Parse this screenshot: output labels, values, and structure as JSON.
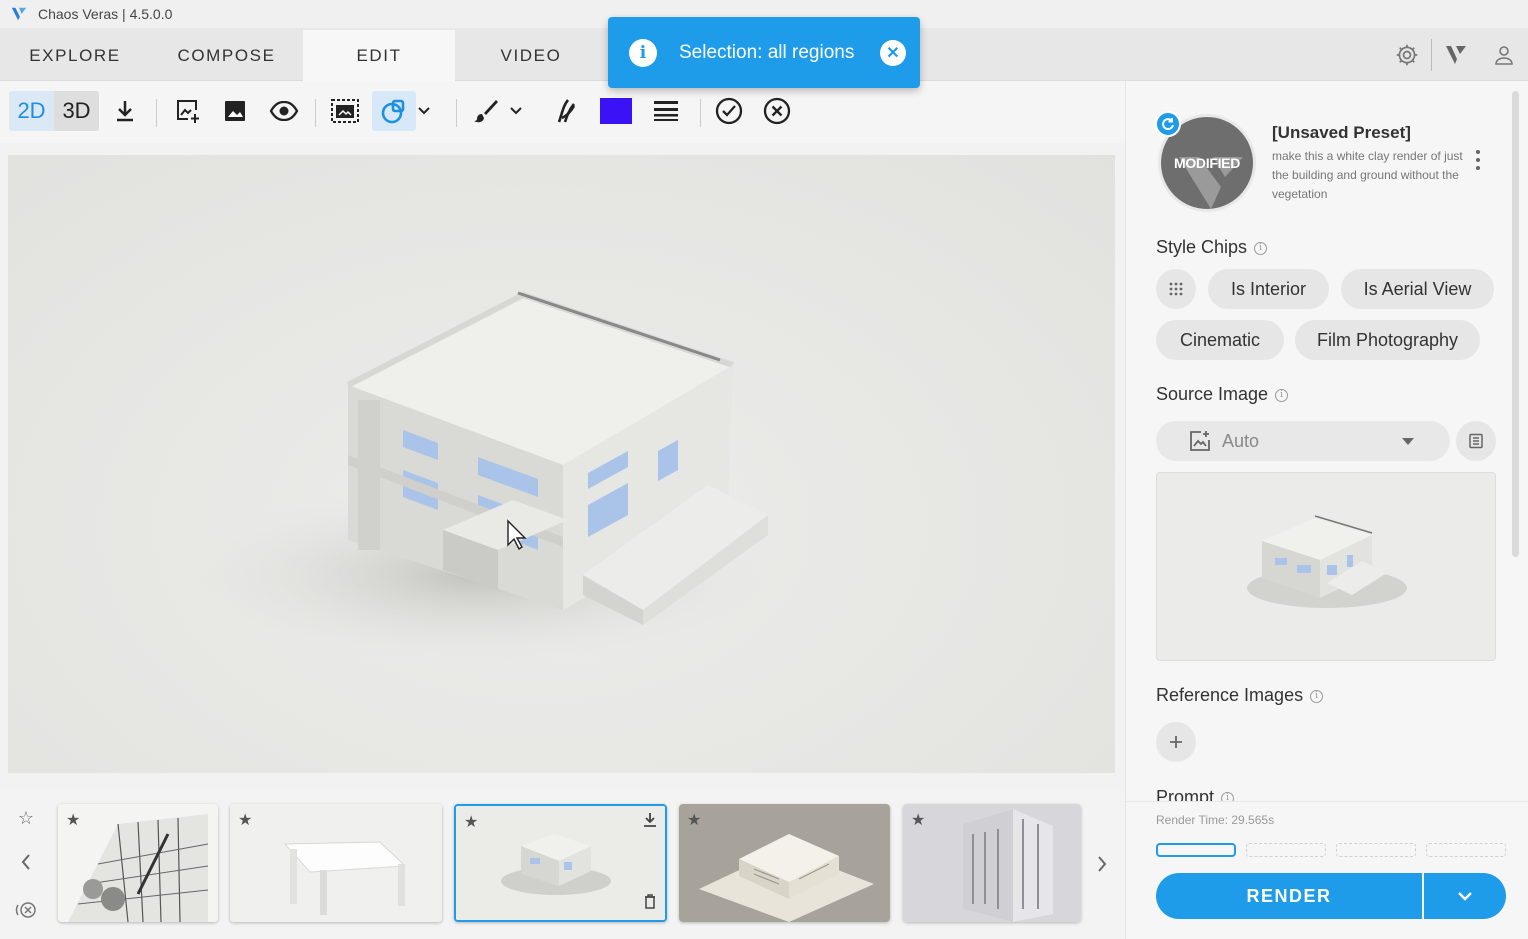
{
  "app": {
    "title": "Chaos Veras | 4.5.0.0"
  },
  "nav": {
    "tabs": [
      {
        "label": "EXPLORE"
      },
      {
        "label": "COMPOSE"
      },
      {
        "label": "EDIT",
        "active": true
      },
      {
        "label": "VIDEO"
      }
    ],
    "right_icons": [
      "settings-icon",
      "veras-logo-icon",
      "user-icon"
    ]
  },
  "toast": {
    "message": "Selection: all regions",
    "icon": "info-icon"
  },
  "toolbar": {
    "mode_2d": "2D",
    "mode_3d": "3D",
    "active_mode": "2D",
    "icons": [
      "download-icon",
      "add-image-icon",
      "image-icon",
      "eye-icon",
      "select-region-icon",
      "shape-select-icon",
      "brush-icon",
      "feather-icon",
      "color-swatch",
      "line-weight-icon",
      "accept-icon",
      "reject-icon"
    ],
    "swatch_color": "#3a12f5"
  },
  "thumbnails": [
    {
      "name": "sketch-interior"
    },
    {
      "name": "white-table"
    },
    {
      "name": "white-clay-building",
      "selected": true
    },
    {
      "name": "beige-model-building"
    },
    {
      "name": "white-tower"
    }
  ],
  "panel": {
    "preset": {
      "badge": "MODIFIED",
      "title": "[Unsaved Preset]",
      "description": "make this a white clay render of just the building and ground without the vegetation"
    },
    "style_chips": {
      "label": "Style Chips",
      "chips": [
        "Is Interior",
        "Is Aerial View",
        "Cinematic",
        "Film Photography"
      ]
    },
    "source_image": {
      "label": "Source Image",
      "selected": "Auto"
    },
    "reference_images": {
      "label": "Reference Images"
    },
    "prompt": {
      "label": "Prompt"
    },
    "render": {
      "time": "Render Time: 29.565s",
      "button": "RENDER"
    }
  },
  "colors": {
    "accent": "#1e9be9",
    "swatch": "#3a12f5"
  }
}
